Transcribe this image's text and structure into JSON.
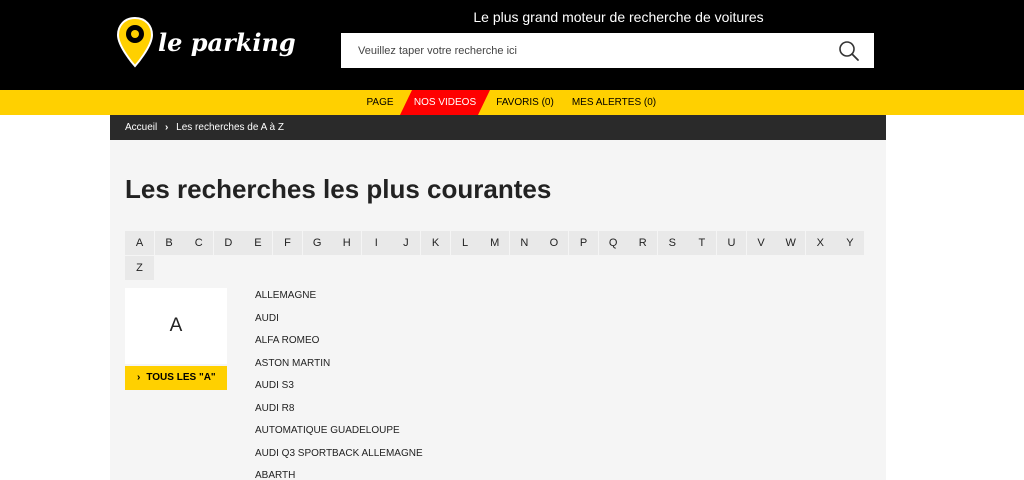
{
  "header": {
    "logo_text": "le parking",
    "tagline": "Le plus grand moteur de recherche de voitures",
    "search": {
      "placeholder": "Veuillez taper votre recherche ici",
      "value": ""
    },
    "colors": {
      "background": "#000000",
      "accent": "#ffd000"
    }
  },
  "nav": {
    "items": [
      {
        "label": "PAGE"
      },
      {
        "label": "NOS VIDEOS",
        "highlight": "#ff0000"
      },
      {
        "label": "FAVORIS (0)"
      },
      {
        "label": "MES ALERTES (0)"
      }
    ]
  },
  "breadcrumb": {
    "items": [
      {
        "label": "Accueil"
      },
      {
        "label": "Les recherches de A à Z"
      }
    ],
    "separator": "›"
  },
  "main": {
    "title": "Les recherches les plus courantes",
    "alphabet": [
      "A",
      "B",
      "C",
      "D",
      "E",
      "F",
      "G",
      "H",
      "I",
      "J",
      "K",
      "L",
      "M",
      "N",
      "O",
      "P",
      "Q",
      "R",
      "S",
      "T",
      "U",
      "V",
      "W",
      "X",
      "Y",
      "Z"
    ],
    "selected_letter": "A",
    "all_button_label": "TOUS LES \"A\"",
    "results": [
      "ALLEMAGNE",
      "AUDI",
      "ALFA ROMEO",
      "ASTON MARTIN",
      "AUDI S3",
      "AUDI R8",
      "AUTOMATIQUE GUADELOUPE",
      "AUDI Q3 SPORTBACK ALLEMAGNE",
      "ABARTH"
    ]
  }
}
